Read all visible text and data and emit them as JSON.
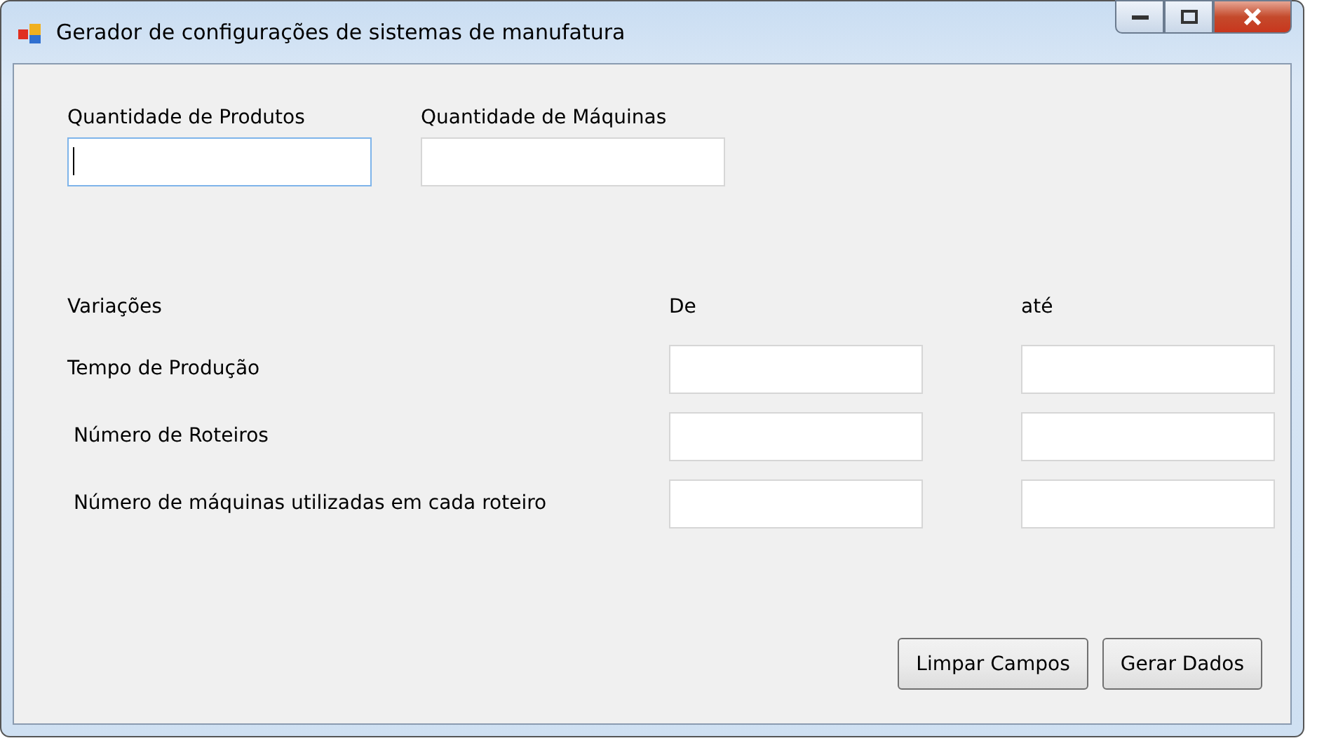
{
  "window": {
    "title": "Gerador de configurações de sistemas de manufatura"
  },
  "top_fields": [
    {
      "label": "Quantidade de Produtos",
      "focused": true
    },
    {
      "label": "Quantidade de Máquinas",
      "focused": false
    }
  ],
  "variations": {
    "title": "Variações",
    "from_label": "De",
    "to_label": "até",
    "rows": [
      {
        "label": "Tempo de Produção"
      },
      {
        "label": " Número de Roteiros"
      },
      {
        "label": " Número de máquinas utilizadas em cada roteiro"
      }
    ]
  },
  "buttons": [
    "Limpar Campos",
    "Gerar Dados"
  ]
}
